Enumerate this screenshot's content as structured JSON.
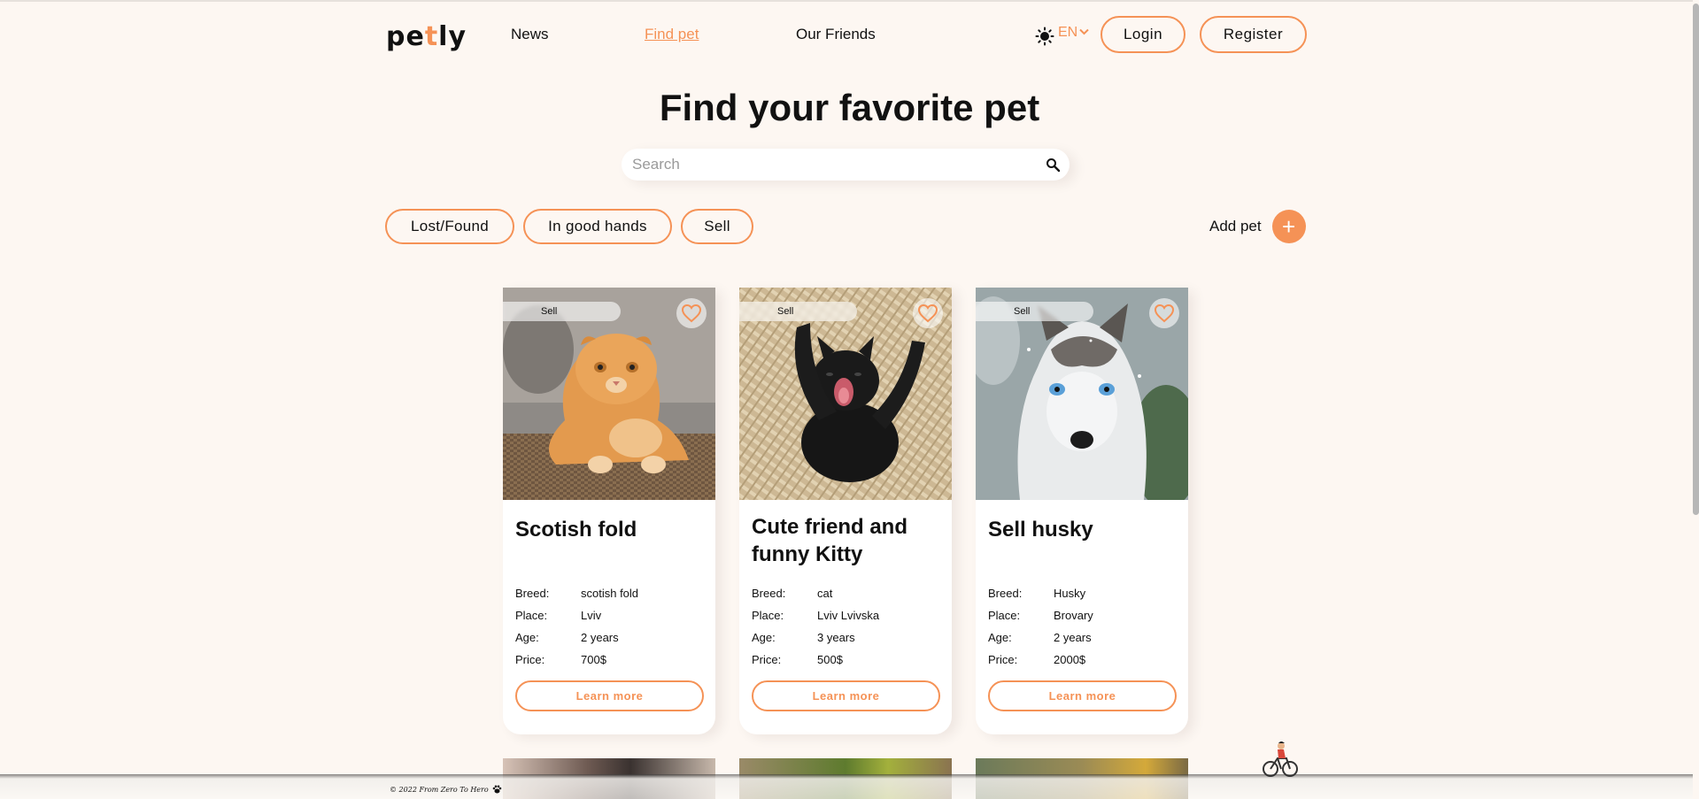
{
  "header": {
    "logo_prefix": "pe",
    "logo_accent": "t",
    "logo_suffix": "ly",
    "nav": {
      "news": "News",
      "find_pet": "Find pet",
      "our_friends": "Our Friends"
    },
    "lang": "EN",
    "login": "Login",
    "register": "Register"
  },
  "main": {
    "title": "Find your favorite pet",
    "search_placeholder": "Search",
    "filters": {
      "lost_found": "Lost/Found",
      "in_good_hands": "In good hands",
      "sell": "Sell"
    },
    "add_pet_label": "Add pet",
    "add_pet_symbol": "+"
  },
  "labels": {
    "breed": "Breed:",
    "place": "Place:",
    "age": "Age:",
    "price": "Price:",
    "learn_more": "Learn more"
  },
  "cards": [
    {
      "category": "Sell",
      "title": "Scotish fold",
      "breed": "scotish fold",
      "place": "Lviv",
      "age": "2 years",
      "price": "700$"
    },
    {
      "category": "Sell",
      "title": "Cute friend and funny Kitty",
      "breed": "cat",
      "place": "Lviv Lvivska",
      "age": "3 years",
      "price": "500$"
    },
    {
      "category": "Sell",
      "title": "Sell husky",
      "breed": "Husky",
      "place": "Brovary",
      "age": "2 years",
      "price": "2000$"
    }
  ],
  "footer": {
    "text": "© 2022 From Zero To Hero"
  },
  "colors": {
    "accent": "#f59256",
    "background": "#fdf7f2"
  }
}
